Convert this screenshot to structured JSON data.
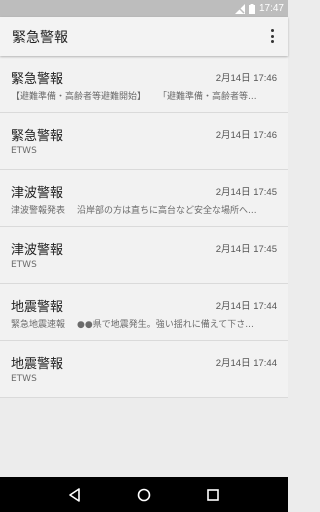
{
  "status_bar": {
    "time": "17:47",
    "icons": [
      "signal-off-icon",
      "battery-icon"
    ]
  },
  "app_bar": {
    "title": "緊急警報",
    "menu_icon": "overflow-menu-icon"
  },
  "items": [
    {
      "title": "緊急警報",
      "date": "2月14日 17:46",
      "sub_a": "【避難準備・高齢者等避難開始】",
      "sub_b": "「避難準備・高齢者等..."
    },
    {
      "title": "緊急警報",
      "date": "2月14日 17:46",
      "sub_a": "ETWS",
      "sub_b": ""
    },
    {
      "title": "津波警報",
      "date": "2月14日 17:45",
      "sub_a": "津波警報発表",
      "sub_b": "沿岸部の方は直ちに高台など安全な場所へ..."
    },
    {
      "title": "津波警報",
      "date": "2月14日 17:45",
      "sub_a": "ETWS",
      "sub_b": ""
    },
    {
      "title": "地震警報",
      "date": "2月14日 17:44",
      "sub_a": "緊急地震速報",
      "sub_b": "●●県で地震発生。強い揺れに備えて下さ..."
    },
    {
      "title": "地震警報",
      "date": "2月14日 17:44",
      "sub_a": "ETWS",
      "sub_b": ""
    }
  ],
  "nav_bar": {
    "buttons": [
      "back-icon",
      "home-icon",
      "recents-icon"
    ]
  }
}
